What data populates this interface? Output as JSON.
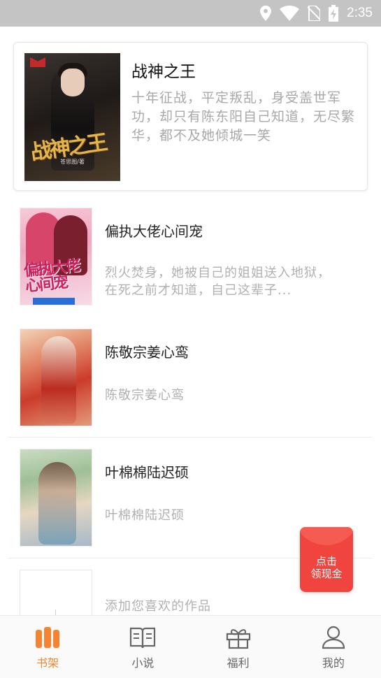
{
  "status_bar": {
    "time": "2:35",
    "icons": [
      "location-icon",
      "wifi-icon",
      "no-sim-icon",
      "battery-charging-icon"
    ]
  },
  "featured_book": {
    "title": "战神之王",
    "description": "十年征战，平定叛乱，身受盖世军功，却只有陈东阳自己知道，无尽繁华，都不及她倾城一笑",
    "cover_art_title": "战神之王",
    "cover_author": "苍思图/著"
  },
  "books": [
    {
      "title": "偏执大佬心间宠",
      "description": "烈火焚身，她被自己的姐姐送入地狱，在死之前才知道，自己这辈子...",
      "cover_art_title": "偏执大佬心间宠"
    },
    {
      "title": "陈敬宗姜心鸾",
      "description": "陈敬宗姜心鸾"
    },
    {
      "title": "叶棉棉陆迟硕",
      "description": "叶棉棉陆迟硕"
    }
  ],
  "add_placeholder": {
    "text": "添加您喜欢的作品"
  },
  "red_packet": {
    "line1": "点击",
    "line2": "领现金"
  },
  "bottom_nav": {
    "items": [
      {
        "label": "书架",
        "icon": "bookshelf-icon",
        "active": true
      },
      {
        "label": "小说",
        "icon": "open-book-icon",
        "active": false
      },
      {
        "label": "福利",
        "icon": "gift-icon",
        "active": false
      },
      {
        "label": "我的",
        "icon": "user-icon",
        "active": false
      }
    ]
  },
  "colors": {
    "accent": "#f5832f",
    "red_packet": "#f0453f",
    "status_bar": "#c4c4c4"
  }
}
